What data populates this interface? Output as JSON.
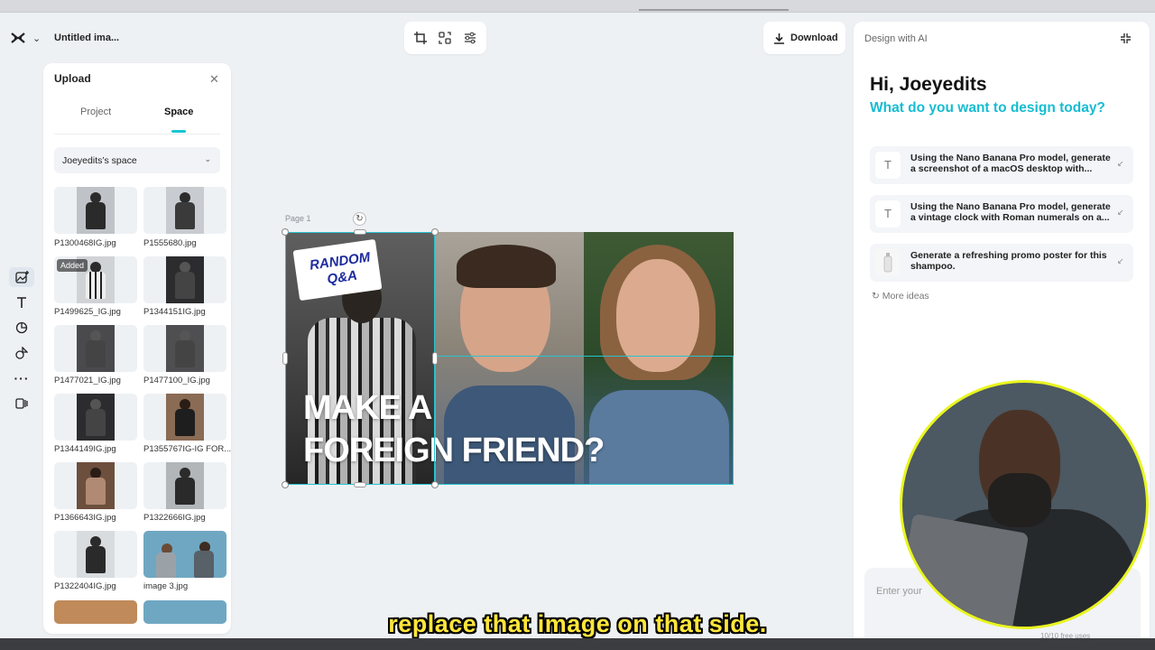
{
  "app": {
    "doc_title": "Untitled ima...",
    "download_label": "Download"
  },
  "upload_panel": {
    "title": "Upload",
    "tabs": [
      "Project",
      "Space"
    ],
    "active_tab": "Space",
    "space_select": "Joeyedits’s space",
    "added_badge": "Added",
    "files": [
      {
        "name": "P1300468IG.jpg"
      },
      {
        "name": "P1555680.jpg"
      },
      {
        "name": "P1499625_IG.jpg"
      },
      {
        "name": "P1344151IG.jpg"
      },
      {
        "name": "P1477021_IG.jpg"
      },
      {
        "name": "P1477100_IG.jpg"
      },
      {
        "name": "P1344149IG.jpg"
      },
      {
        "name": "P1355767IG-IG FOR..."
      },
      {
        "name": "P1366643IG.jpg"
      },
      {
        "name": "P1322666IG.jpg"
      },
      {
        "name": "P1322404IG.jpg"
      },
      {
        "name": "image 3.jpg"
      }
    ]
  },
  "canvas": {
    "page_label": "Page 1",
    "badge_text": "RANDOM Q&A",
    "headline_line1": "MAKE A",
    "headline_line2": "FOREIGN FRIEND?"
  },
  "ai_panel": {
    "header": "Design with AI",
    "greeting": "Hi, Joeyedits",
    "question": "What do you want to design today?",
    "suggestions": [
      {
        "text": "Using the Nano Banana Pro model, generate a screenshot of a macOS desktop with...",
        "icon": "text-icon"
      },
      {
        "text": "Using the Nano Banana Pro model, generate a vintage clock with Roman numerals on a...",
        "icon": "text-icon"
      },
      {
        "text": "Generate a refreshing promo poster for this shampoo.",
        "icon": "shampoo-thumbnail"
      }
    ],
    "more_ideas": "More ideas",
    "prompt_placeholder": "Enter your",
    "free_uses": "10/10 free uses"
  },
  "subtitle": "replace that image on that side.",
  "colors": {
    "accent": "#18c5d3",
    "question_blue": "#17bcd2",
    "subtitle_yellow": "#ffe63a",
    "webcam_ring": "#e9f51e"
  }
}
